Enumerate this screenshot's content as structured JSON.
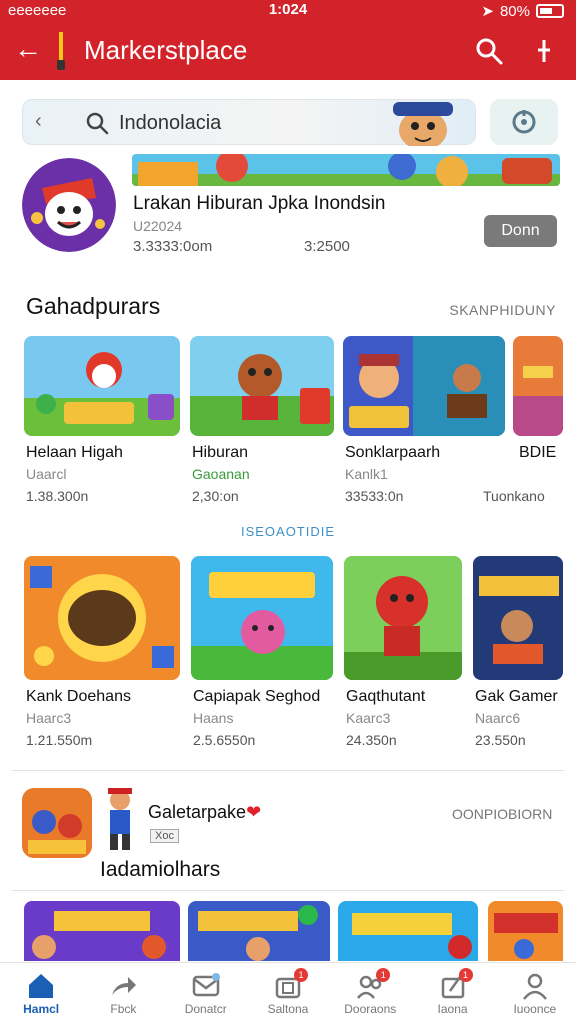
{
  "status_bar": {
    "carrier": "eeeeeee",
    "time": "1:024",
    "battery": "80%"
  },
  "app_bar": {
    "title": "Markerstplace"
  },
  "search": {
    "value": "Indonolacia"
  },
  "featured": {
    "title": "Lrakan Hiburan Jpka Inondsin",
    "subtitle": "U22024",
    "downloads": "3.3333:0om",
    "size": "3:2500",
    "action_label": "Donn"
  },
  "section1": {
    "title": "Gahadpurars",
    "link": "SKANPHIDUNY",
    "apps": [
      {
        "name": "Helaan Higah",
        "sub": "Uaarcl",
        "size": "1.38.300n",
        "sub_color": "#888888"
      },
      {
        "name": "Hiburan",
        "sub": "Gaoanan",
        "size": "2,30:on",
        "sub_color": "#3a9a3a"
      },
      {
        "name": "Sonklarpaarh",
        "sub": "Kanlk1",
        "size": "33533:0n",
        "sub_color": "#888888"
      },
      {
        "name": "BDIE",
        "sub": "",
        "size": "Tuonkano",
        "sub_color": "#888888"
      }
    ]
  },
  "mid_label": "ISEOAOTIDIE",
  "section2": {
    "apps": [
      {
        "name": "Kank Doehans",
        "sub": "Haarc3",
        "size": "1.21.550m"
      },
      {
        "name": "Capiapak Seghod",
        "sub": "Haans",
        "size": "2.5.6550n"
      },
      {
        "name": "Gaqthutant",
        "sub": "Kaarc3",
        "size": "24.350n"
      },
      {
        "name": "Gak Gamer",
        "sub": "Naarc6",
        "size": "23.550n"
      }
    ]
  },
  "promo": {
    "title": "Galetarpake",
    "badge": "Xoc",
    "link": "OONPIOBIORN",
    "subtitle": "Iadamiolhars"
  },
  "bottom_nav": [
    {
      "label": "Hamcl",
      "icon": "home-icon"
    },
    {
      "label": "Fbck",
      "icon": "share-arrow-icon"
    },
    {
      "label": "Donatcr",
      "icon": "message-icon"
    },
    {
      "label": "Saltona",
      "icon": "wallet-icon",
      "badge": "1"
    },
    {
      "label": "Dooraons",
      "icon": "users-icon",
      "badge": "1"
    },
    {
      "label": "Iaona",
      "icon": "edit-icon",
      "badge": "1"
    },
    {
      "label": "Iuoonce",
      "icon": "profile-icon"
    }
  ],
  "colors": {
    "brand_red": "#d3232a",
    "nav_active": "#1a5fb4"
  }
}
